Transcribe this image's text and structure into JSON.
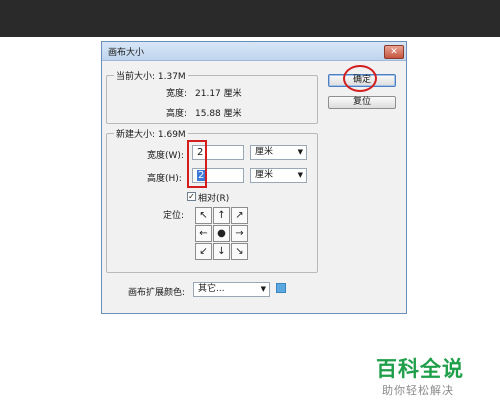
{
  "dialog": {
    "title": "画布大小",
    "close_glyph": "✕",
    "current": {
      "legend": "当前大小: 1.37M",
      "width_label": "宽度:",
      "width_value": "21.17 厘米",
      "height_label": "高度:",
      "height_value": "15.88 厘米"
    },
    "new": {
      "legend": "新建大小: 1.69M",
      "width_label": "宽度(W):",
      "width_value": "2",
      "width_unit": "厘米",
      "height_label": "高度(H):",
      "height_value": "2",
      "height_unit": "厘米",
      "relative_label": "相对(R)",
      "relative_checked": true,
      "anchor_label": "定位:",
      "anchor_glyphs": [
        "↖",
        "↑",
        "↗",
        "←",
        "●",
        "→",
        "↙",
        "↓",
        "↘"
      ]
    },
    "extension_color_label": "画布扩展颜色:",
    "extension_color_value": "其它...",
    "extension_color_swatch": "#5aa9e0",
    "ok_button": "确定",
    "reset_button": "复位"
  },
  "watermark": {
    "logo": "百科全说",
    "tagline": "助你轻松解决"
  },
  "colors": {
    "annotation": "#d21e1e",
    "brand_green": "#1f9f4a"
  }
}
